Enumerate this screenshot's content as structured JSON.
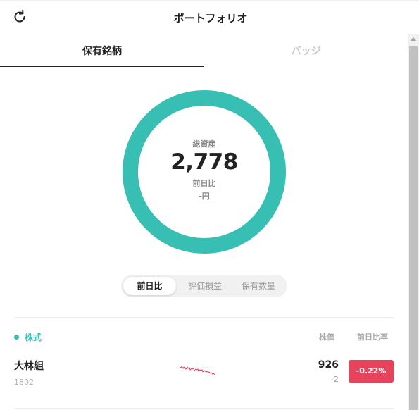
{
  "header": {
    "title": "ポートフォリオ",
    "refresh_icon": "refresh-icon"
  },
  "tabs": [
    {
      "label": "保有銘柄",
      "active": true
    },
    {
      "label": "バッジ",
      "active": false
    }
  ],
  "summary": {
    "total_label": "総資産",
    "total_value": "2,778",
    "change_label": "前日比",
    "change_value": "-円",
    "ring_color": "#38bfb3"
  },
  "segmented": [
    {
      "label": "前日比",
      "active": true
    },
    {
      "label": "評価損益",
      "active": false
    },
    {
      "label": "保有数量",
      "active": false
    }
  ],
  "holdings": {
    "section_title": "株式",
    "section_color": "#38bfb3",
    "columns": {
      "price": "株価",
      "rate": "前日比率"
    },
    "rows": [
      {
        "name": "大林組",
        "code": "1802",
        "price": "926",
        "change": "-2",
        "rate": "-0.22%",
        "rate_color": "#e8435c",
        "sparkline_color": "#e8435c"
      }
    ]
  }
}
